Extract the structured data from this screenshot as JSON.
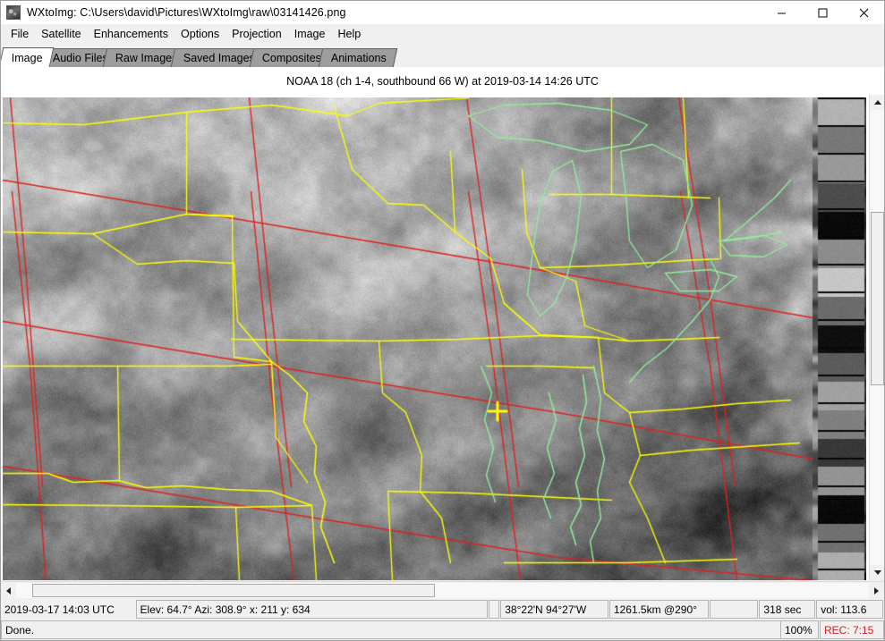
{
  "window": {
    "title": "WXtoImg: C:\\Users\\david\\Pictures\\WXtoImg\\raw\\03141426.png",
    "icon": "app-thumbnail-icon",
    "controls": {
      "minimize": "minimize-icon",
      "maximize": "maximize-icon",
      "close": "close-icon"
    }
  },
  "menubar": {
    "items": [
      {
        "label": "File"
      },
      {
        "label": "Satellite"
      },
      {
        "label": "Enhancements"
      },
      {
        "label": "Options"
      },
      {
        "label": "Projection"
      },
      {
        "label": "Image"
      },
      {
        "label": "Help"
      }
    ]
  },
  "tabs": {
    "active_index": 0,
    "items": [
      {
        "label": "Image"
      },
      {
        "label": "Audio Files"
      },
      {
        "label": "Raw Images"
      },
      {
        "label": "Saved Images"
      },
      {
        "label": "Composites"
      },
      {
        "label": "Animations"
      }
    ]
  },
  "caption": {
    "text": "NOAA 18 (ch 1-4, southbound 66 W) at 2019-03-14  14:26 UTC"
  },
  "image_view": {
    "description": "NOAA APT greyscale satellite image of the central and eastern United States with yellow political borders, green coastlines and lake outlines, red latitude/longitude gridlines, a yellow crosshair marker, and a greyscale telemetry calibration wedge along the right edge",
    "marker": "crosshair-marker",
    "overlay_colors": {
      "borders": "#ffff00",
      "coastline": "#90ee9a",
      "gridlines": "#dd2222",
      "marker": "#ffff00"
    }
  },
  "scrollbars": {
    "vertical": {
      "up": "scroll-up-icon",
      "down": "scroll-down-icon"
    },
    "horizontal": {
      "left": "scroll-left-icon",
      "right": "scroll-right-icon"
    }
  },
  "status_row_1": {
    "timestamp": "2019-03-17  14:03 UTC",
    "telemetry": "Elev: 64.7°  Azi: 308.9°  x: 211  y: 634",
    "blank1": "",
    "coordinates": "38°22'N 94°27'W",
    "range": "1261.5km @290°",
    "blank2": "",
    "duration": "318 sec",
    "volume": "vol: 113.6"
  },
  "status_row_2": {
    "message": "Done.",
    "blank1": "",
    "blank2": "",
    "zoom": "100%",
    "recording": "REC: 7:15"
  }
}
